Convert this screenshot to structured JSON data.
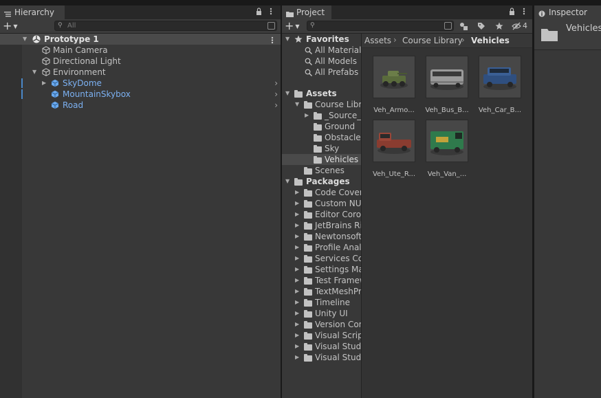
{
  "hierarchy": {
    "tab_label": "Hierarchy",
    "search_placeholder": "All",
    "scene_name": "Prototype 1",
    "items": [
      {
        "label": "Main Camera"
      },
      {
        "label": "Directional Light"
      },
      {
        "label": "Environment"
      },
      {
        "label": "SkyDome"
      },
      {
        "label": "MountainSkybox"
      },
      {
        "label": "Road"
      }
    ]
  },
  "project": {
    "tab_label": "Project",
    "hidden_count": "4",
    "favorites": {
      "label": "Favorites",
      "items": [
        "All Materials",
        "All Models",
        "All Prefabs"
      ]
    },
    "assets": {
      "label": "Assets",
      "course_library": "Course Libra",
      "children": [
        "_Source_",
        "Ground",
        "Obstacles",
        "Sky",
        "Vehicles"
      ],
      "scenes": "Scenes"
    },
    "packages": {
      "label": "Packages",
      "items": [
        "Code Cover",
        "Custom NU",
        "Editor Corou",
        "JetBrains Ri",
        "Newtonsoft",
        "Profile Analy",
        "Services Co",
        "Settings Ma",
        "Test Framew",
        "TextMeshPr",
        "Timeline",
        "Unity UI",
        "Version Con",
        "Visual Scrip",
        "Visual Studi",
        "Visual Studi"
      ]
    },
    "breadcrumb": [
      "Assets",
      "Course Library",
      "Vehicles"
    ],
    "assets_grid": [
      {
        "label": "Veh_Armo...",
        "color": "#5a6b3c"
      },
      {
        "label": "Veh_Bus_B...",
        "color": "#9a9a9a"
      },
      {
        "label": "Veh_Car_B...",
        "color": "#2f4f7f"
      },
      {
        "label": "Veh_Ute_R...",
        "color": "#8a3c30"
      },
      {
        "label": "Veh_Van_...",
        "color": "#2f7a4c"
      }
    ]
  },
  "inspector": {
    "tab_label": "Inspector",
    "title": "Vehicles"
  }
}
